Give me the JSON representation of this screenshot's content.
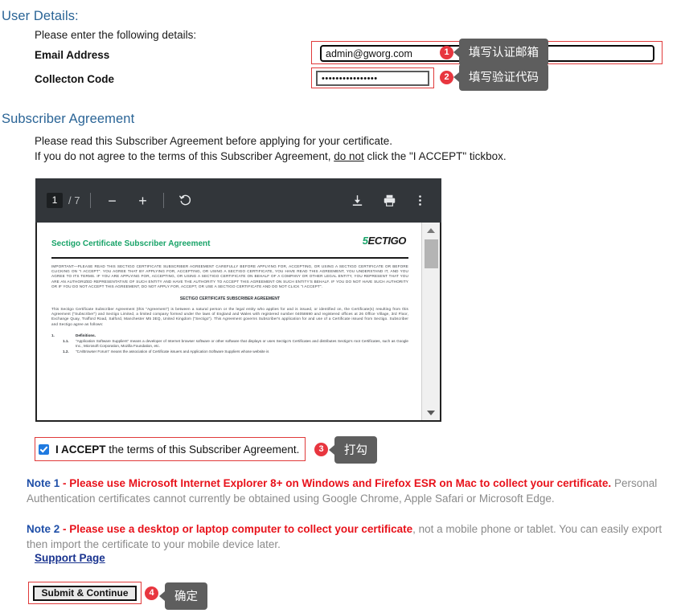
{
  "user_details": {
    "heading": "User Details:",
    "intro": "Please enter the following details:",
    "email_label": "Email Address",
    "email_value": "admin@gworg.com",
    "code_label": "Collecton Code",
    "code_value": "••••••••••••••••"
  },
  "callouts": [
    {
      "number": "1",
      "text": "填写认证邮箱"
    },
    {
      "number": "2",
      "text": "填写验证代码"
    },
    {
      "number": "3",
      "text": "打勾"
    },
    {
      "number": "4",
      "text": "确定"
    }
  ],
  "subscriber": {
    "heading": "Subscriber Agreement",
    "line1": "Please read this Subscriber Agreement before applying for your certificate.",
    "line2_a": "If you do not agree to the terms of this Subscriber Agreement, ",
    "line2_u": "do not",
    "line2_b": " click the \"I ACCEPT\" tickbox."
  },
  "pdf": {
    "page_current": "1",
    "page_total": "/ 7",
    "zoom_out_label": "−",
    "zoom_in_label": "+",
    "rotate_label": "rotate-counterclockwise",
    "download_label": "download",
    "print_label": "print",
    "more_label": "more-options",
    "document": {
      "title": "Sectigo Certificate Subscriber Agreement",
      "logo_mark": "5",
      "logo_text": "ECTIGO",
      "para1": "IMPORTANT—PLEASE READ THIS SECTIGO CERTIFICATE SUBSCRIBER AGREEMENT CAREFULLY BEFORE APPLYING FOR, ACCEPTING, OR USING A SECTIGO CERTIFICATE OR BEFORE CLICKING ON \"I ACCEPT\". YOU AGREE THAT BY APPLYING FOR, ACCEPTING, OR USING A SECTIGO CERTIFICATE, YOU HAVE READ THIS AGREEMENT, YOU UNDERSTAND IT, AND YOU AGREE TO ITS TERMS. IF YOU ARE APPLYING FOR, ACCEPTING, OR USING A SECTIGO CERTIFICATE ON BEHALF OF A COMPANY OR OTHER LEGAL ENTITY, YOU REPRESENT THAT YOU ARE AN AUTHORIZED REPRESENTATIVE OF SUCH ENTITY AND HAVE THE AUTHORITY TO ACCEPT THIS AGREEMENT ON SUCH ENTITY'S BEHALF. IF YOU DO NOT HAVE SUCH AUTHORITY OR IF YOU DO NOT ACCEPT THIS AGREEMENT, DO NOT APPLY FOR, ACCEPT, OR USE A SECTIGO CERTIFICATE AND DO NOT CLICK \"I ACCEPT\".",
      "heading2": "SECTIGO CERTIFICATE SUBSCRIBER AGREEMENT",
      "para2": "This Sectigo Certificate Subscriber Agreement (this \"Agreement\") is between a natural person or the legal entity who applies for and is issued, or identified on, the Certificate(s) resulting from this Agreement (\"Subscriber\") and Sectigo Limited, a limited company formed under the laws of England and Wales with registered number 04058690 and registered offices at 26 Office Village, 3rd Floor, Exchange Quay, Trafford Road, Salford, Manchester M5 3EQ, United Kingdom (\"Sectigo\"). This Agreement governs Subscriber's application for and use of a Certificate issued from Sectigo. Subscriber and Sectigo agree as follows:",
      "item1_num": "1.",
      "item1_text": "Definitions.",
      "item11_num": "1.1.",
      "item11_text": "\"Application Software Suppliers\" means a developer of Internet browser software or other software that displays or uses Sectigo's Certificates and distributes Sectigo's root Certificates, such as Google Inc., Microsoft Corporation, Mozilla Foundation, etc.",
      "item12_num": "1.2.",
      "item12_text": "\"CA/Browser Forum\" means the association of Certificate issuers and Application Software Suppliers whose website is"
    }
  },
  "accept": {
    "bold": "I ACCEPT",
    "rest": " the terms of this Subscriber Agreement."
  },
  "notes": {
    "note1_label": "Note 1",
    "note1_dash": " - ",
    "note1_em": "Please use Microsoft Internet Explorer 8+ on Windows and Firefox ESR on Mac to collect your certificate.",
    "note1_rest": " Personal Authentication certificates cannot currently be obtained using Google Chrome, Apple Safari or Microsoft Edge.",
    "note2_label": "Note 2",
    "note2_dash": " - ",
    "note2_em": "Please use a desktop or laptop computer to collect your certificate",
    "note2_rest": ", not a mobile phone or tablet. You can easily export then import the certificate to your mobile device later.",
    "support_link": "Support Page"
  },
  "submit": {
    "label": "Submit & Continue"
  }
}
